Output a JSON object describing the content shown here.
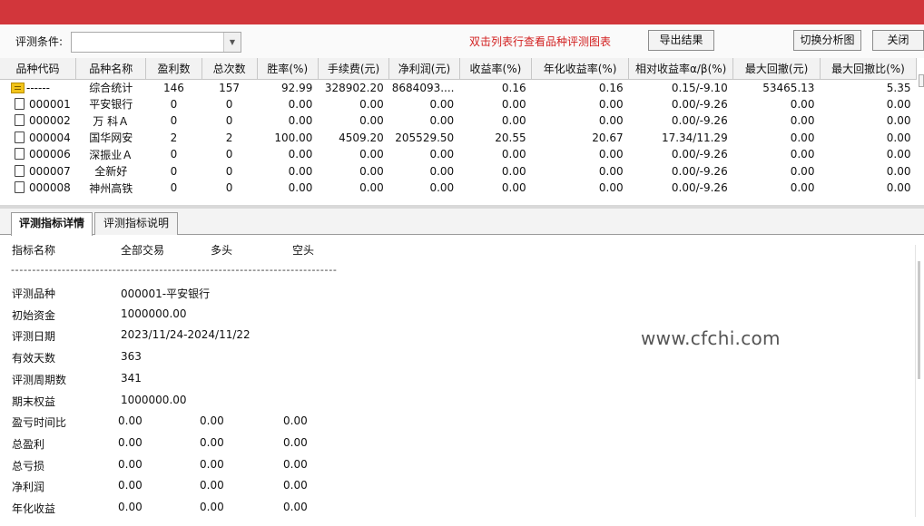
{
  "toolbar": {
    "condition_label": "评测条件:",
    "condition_value": "",
    "hint": "双击列表行查看品种评测图表",
    "export_label": "导出结果",
    "switch_label": "切换分析图",
    "close_label": "关闭"
  },
  "grid": {
    "columns": [
      "品种代码",
      "品种名称",
      "盈利数",
      "总次数",
      "胜率(%)",
      "手续费(元)",
      "净利润(元)",
      "收益率(%)",
      "年化收益率(%)",
      "相对收益率α/β(%)",
      "最大回撤(元)",
      "最大回撤比(%)"
    ],
    "rows": [
      [
        "------",
        "综合统计",
        "146",
        "157",
        "92.99",
        "328902.20",
        "8684093....",
        "0.16",
        "0.16",
        "0.15/-9.10",
        "53465.13",
        "5.35"
      ],
      [
        "000001",
        "平安银行",
        "0",
        "0",
        "0.00",
        "0.00",
        "0.00",
        "0.00",
        "0.00",
        "0.00/-9.26",
        "0.00",
        "0.00"
      ],
      [
        "000002",
        "万 科Ａ",
        "0",
        "0",
        "0.00",
        "0.00",
        "0.00",
        "0.00",
        "0.00",
        "0.00/-9.26",
        "0.00",
        "0.00"
      ],
      [
        "000004",
        "国华网安",
        "2",
        "2",
        "100.00",
        "4509.20",
        "205529.50",
        "20.55",
        "20.67",
        "17.34/11.29",
        "0.00",
        "0.00"
      ],
      [
        "000006",
        "深振业Ａ",
        "0",
        "0",
        "0.00",
        "0.00",
        "0.00",
        "0.00",
        "0.00",
        "0.00/-9.26",
        "0.00",
        "0.00"
      ],
      [
        "000007",
        "全新好",
        "0",
        "0",
        "0.00",
        "0.00",
        "0.00",
        "0.00",
        "0.00",
        "0.00/-9.26",
        "0.00",
        "0.00"
      ],
      [
        "000008",
        "神州高铁",
        "0",
        "0",
        "0.00",
        "0.00",
        "0.00",
        "0.00",
        "0.00",
        "0.00/-9.26",
        "0.00",
        "0.00"
      ]
    ]
  },
  "tabs": [
    "评测指标详情",
    "评测指标说明"
  ],
  "detail": {
    "headers": [
      "指标名称",
      "全部交易",
      "多头",
      "空头"
    ],
    "divider": "-----------------------------------------------------------------------------",
    "rows": [
      {
        "label": "评测品种",
        "all": "000001-平安银行",
        "long": "",
        "short": ""
      },
      {
        "label": "初始资金",
        "all": "1000000.00",
        "long": "",
        "short": ""
      },
      {
        "label": "评测日期",
        "all": "2023/11/24-2024/11/22",
        "long": "",
        "short": ""
      },
      {
        "label": "有效天数",
        "all": "363",
        "long": "",
        "short": ""
      },
      {
        "label": "评测周期数",
        "all": "341",
        "long": "",
        "short": ""
      },
      {
        "label": "期末权益",
        "all": "1000000.00",
        "long": "",
        "short": ""
      },
      {
        "label": "盈亏时间比",
        "all": "0.00",
        "long": "0.00",
        "short": "0.00"
      },
      {
        "label": "总盈利",
        "all": "0.00",
        "long": "0.00",
        "short": "0.00"
      },
      {
        "label": "总亏损",
        "all": "0.00",
        "long": "0.00",
        "short": "0.00"
      },
      {
        "label": "净利润",
        "all": "0.00",
        "long": "0.00",
        "short": "0.00"
      },
      {
        "label": "年化收益",
        "all": "0.00",
        "long": "0.00",
        "short": "0.00"
      }
    ]
  },
  "watermark": "www.cfchi.com"
}
